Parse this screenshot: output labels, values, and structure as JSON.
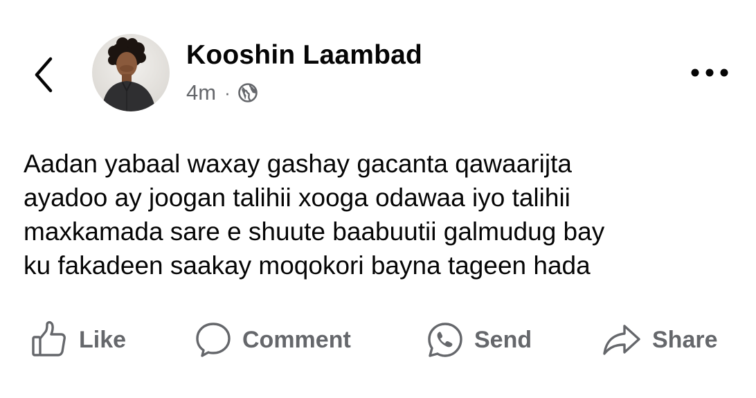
{
  "header": {
    "author_name": "Kooshin Laambad",
    "timestamp": "4m",
    "separator": "·",
    "audience_icon": "globe-icon",
    "back_icon": "chevron-left-icon",
    "more_icon": "more-horizontal-icon"
  },
  "post": {
    "lines": [
      "Aadan yabaal waxay gashay gacanta qawaarijta",
      "ayadoo ay joogan talihii xooga odawaa iyo talihii",
      "maxkamada sare e shuute baabuutii galmudug bay",
      "ku fakadeen saakay moqokori bayna tageen hada"
    ]
  },
  "actions": {
    "like": {
      "label": "Like",
      "icon": "thumbs-up-icon"
    },
    "comment": {
      "label": "Comment",
      "icon": "comment-bubble-icon"
    },
    "send": {
      "label": "Send",
      "icon": "whatsapp-icon"
    },
    "share": {
      "label": "Share",
      "icon": "share-arrow-icon"
    }
  },
  "colors": {
    "text_primary": "#050505",
    "text_secondary": "#65676b",
    "background": "#ffffff"
  }
}
